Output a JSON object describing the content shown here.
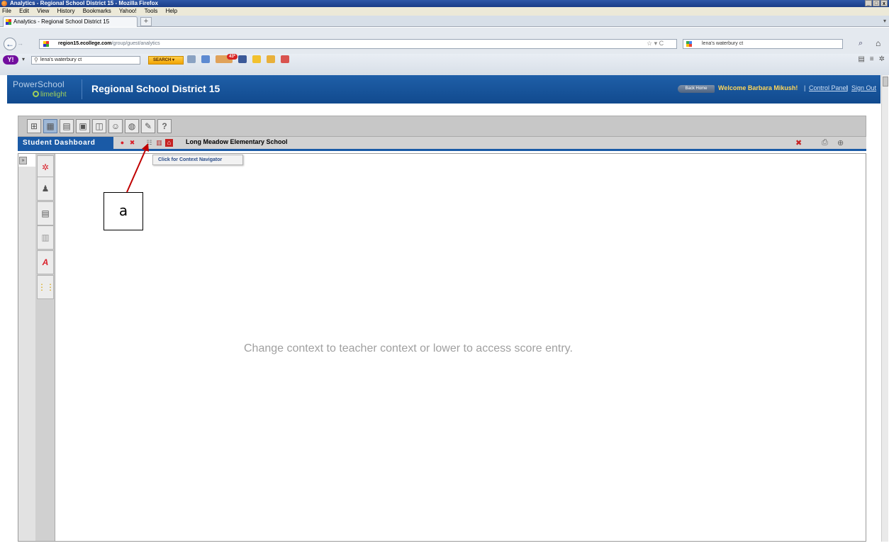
{
  "window": {
    "title": "Analytics - Regional School District 15 - Mozilla Firefox",
    "controls": [
      "_",
      "□",
      "x"
    ]
  },
  "menu": [
    "File",
    "Edit",
    "View",
    "History",
    "Bookmarks",
    "Yahoo!",
    "Tools",
    "Help"
  ],
  "tab": {
    "label": "Analytics - Regional School District 15",
    "new_tab": "+"
  },
  "nav": {
    "url_domain": "region15.ecollege.com",
    "url_path": "/group/guest/analytics",
    "search_text": "lena's waterbury ct"
  },
  "yahoo": {
    "search_text": "lena's waterbury ct",
    "search_button": "SEARCH",
    "mail_badge": "43*"
  },
  "ps_header": {
    "logo_line1": "PowerSchool",
    "logo_line2": "limelight",
    "district": "Regional School District 15",
    "back_home": "Back Home",
    "welcome": "Welcome Barbara Mikush!",
    "control_panel": "Control Panel",
    "sign_out": "Sign Out",
    "separator": "|"
  },
  "toolbar_icons": [
    "grid-icon",
    "dashboard-icon",
    "report-icon",
    "calendar-icon",
    "presentation-icon",
    "group-icon",
    "globe-icon",
    "tools-icon",
    "help-icon"
  ],
  "help_glyph": "?",
  "dashboard": {
    "title": "Student Dashboard",
    "school": "Long Meadow Elementary School",
    "tooltip": "Click for Context Navigator"
  },
  "side_tabs": [
    "settings-icon",
    "person-icon",
    "document-icon",
    "ruler-icon",
    "text-icon",
    "score-icon"
  ],
  "main": {
    "message": "Change context to teacher context or lower to access score entry."
  },
  "annotation": {
    "label": "a",
    "color": "#c00000"
  },
  "colors": {
    "ps_blue": "#1a5aa6",
    "welcome_yellow": "#ffd65a",
    "message_gray": "#a0a0a0"
  }
}
